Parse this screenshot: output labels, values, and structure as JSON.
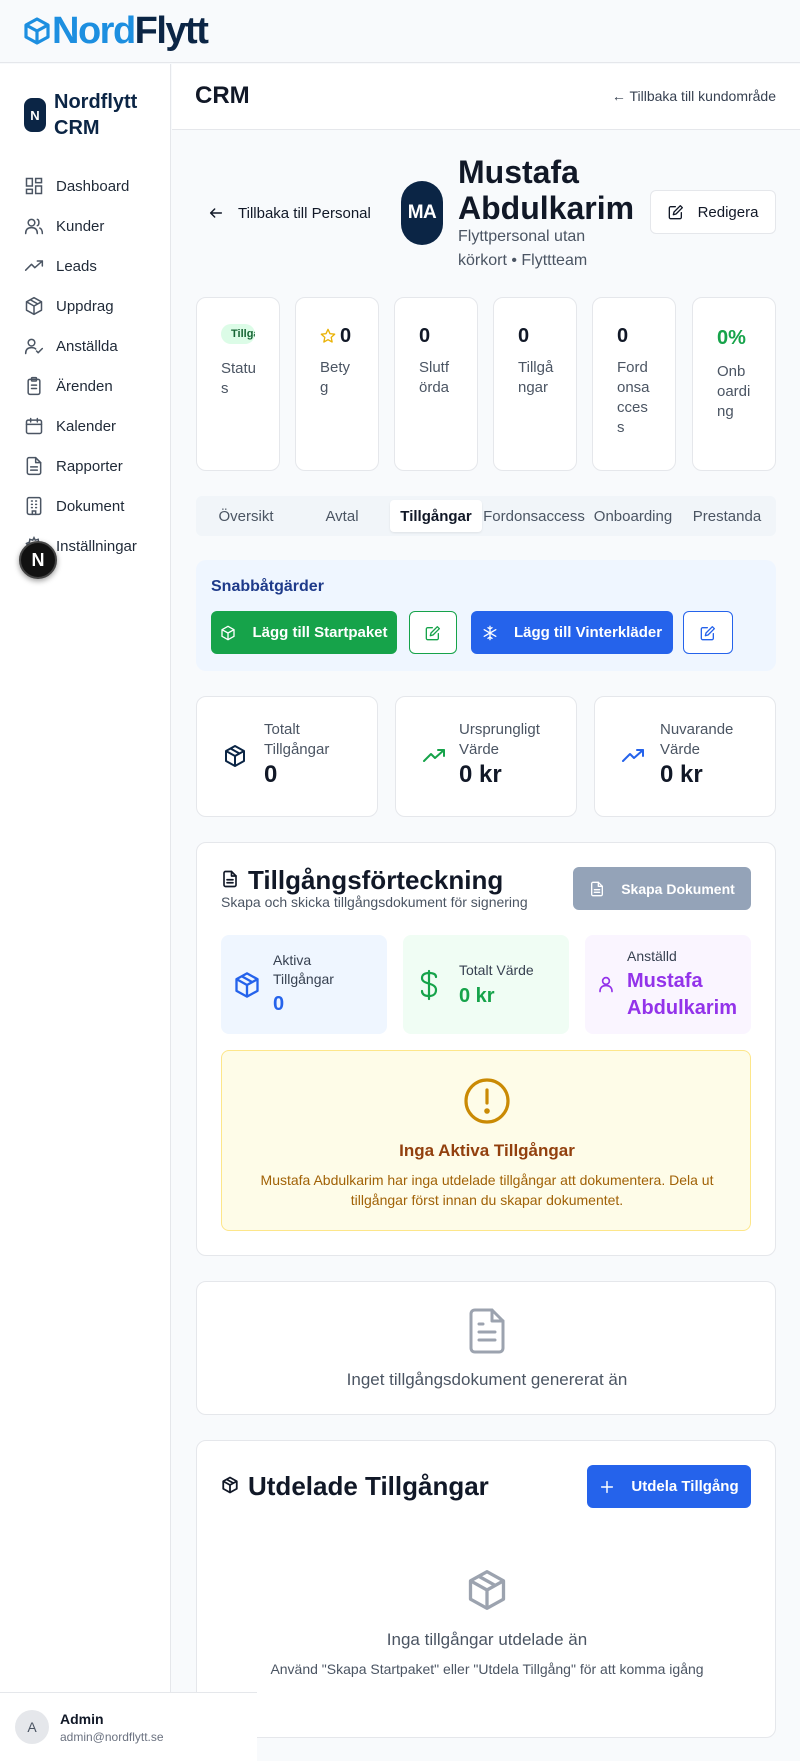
{
  "logo": {
    "nord": "Nord",
    "flytt": "Flytt"
  },
  "sidebar": {
    "brand_badge": "N",
    "brand_name": "Nordflytt CRM",
    "items": [
      {
        "label": "Dashboard",
        "icon": "dashboard-icon"
      },
      {
        "label": "Kunder",
        "icon": "users-icon"
      },
      {
        "label": "Leads",
        "icon": "trending-up-icon"
      },
      {
        "label": "Uppdrag",
        "icon": "package-icon"
      },
      {
        "label": "Anställda",
        "icon": "user-check-icon"
      },
      {
        "label": "Ärenden",
        "icon": "clipboard-icon"
      },
      {
        "label": "Kalender",
        "icon": "calendar-icon"
      },
      {
        "label": "Rapporter",
        "icon": "file-text-icon"
      },
      {
        "label": "Dokument",
        "icon": "building-icon"
      },
      {
        "label": "Inställningar",
        "icon": "gear-icon"
      }
    ],
    "floating_badge": "N",
    "user": {
      "initial": "A",
      "name": "Admin",
      "email": "admin@nordflytt.se"
    }
  },
  "header": {
    "title": "CRM",
    "back_link": "← Tillbaka till kundområde"
  },
  "profile": {
    "back_label": "Tillbaka till Personal",
    "initials": "MA",
    "name": "Mustafa Abdulkarim",
    "subtitle": "Flyttpersonal utan körkort • Flyttteam",
    "edit_label": "Redigera"
  },
  "stats": [
    {
      "value": "Tillgänglig",
      "label": "Status",
      "kind": "pill"
    },
    {
      "value": "0",
      "label": "Betyg",
      "kind": "star"
    },
    {
      "value": "0",
      "label": "Slutförda"
    },
    {
      "value": "0",
      "label": "Tillgångar"
    },
    {
      "value": "0",
      "label": "Fordonsaccess"
    },
    {
      "value": "0%",
      "label": "Onboarding",
      "kind": "green"
    }
  ],
  "tabs": [
    "Översikt",
    "Avtal",
    "Tillgångar",
    "Fordonsaccess",
    "Onboarding",
    "Prestanda"
  ],
  "active_tab": "Tillgångar",
  "quick_actions": {
    "title": "Snabbåtgärder",
    "starter_label": "Lägg till Startpaket",
    "winter_label": "Lägg till Vinterkläder"
  },
  "summary": [
    {
      "label": "Totalt Tillgångar",
      "value": "0",
      "icon": "package-icon"
    },
    {
      "label": "Ursprungligt Värde",
      "value": "0 kr",
      "icon": "trending-up-icon"
    },
    {
      "label": "Nuvarande Värde",
      "value": "0 kr",
      "icon": "trending-up-icon"
    }
  ],
  "register": {
    "title": "Tillgångsförteckning",
    "subtitle": "Skapa och skicka tillgångsdokument för signering",
    "create_doc_label": "Skapa Dokument",
    "active_label": "Aktiva Tillgångar",
    "active_value": "0",
    "total_label": "Totalt Värde",
    "total_value": "0 kr",
    "employee_label": "Anställd",
    "employee_value": "Mustafa Abdulkarim",
    "alert_title": "Inga Aktiva Tillgångar",
    "alert_text": "Mustafa Abdulkarim har inga utdelade tillgångar att dokumentera. Dela ut tillgångar först innan du skapar dokumentet."
  },
  "no_document": "Inget tillgångsdokument genererat än",
  "handed_out": {
    "title": "Utdelade Tillgångar",
    "assign_label": "Utdela Tillgång",
    "empty_title": "Inga tillgångar utdelade än",
    "empty_text": "Använd \"Skapa Startpaket\" eller \"Utdela Tillgång\" för att komma igång"
  },
  "colors": {
    "navy": "#0b2545",
    "logo_blue": "#1d8fe0",
    "green": "#16a34a",
    "blue": "#2563eb",
    "purple": "#9333ea",
    "amber": "#ca8a04"
  }
}
